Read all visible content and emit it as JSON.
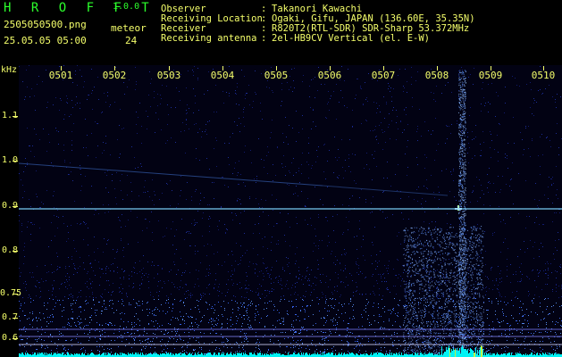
{
  "app": {
    "brand": "H R O F F T",
    "version": "1.0.0",
    "filename": "2505050500.png",
    "datetime": "25.05.05 05:00",
    "meteor_label": "meteor",
    "meteor_count": "24"
  },
  "info": {
    "rows": [
      {
        "label": "Observer",
        "value": "Takanori Kawachi"
      },
      {
        "label": "Receiving Location",
        "value": "Ogaki, Gifu, JAPAN (136.60E, 35.35N)"
      },
      {
        "label": "Receiver",
        "value": "R820T2(RTL-SDR) SDR-Sharp 53.372MHz"
      },
      {
        "label": "Receiving antenna",
        "value": "2el-HB9CV Vertical (el. E-W)"
      }
    ]
  },
  "axes": {
    "khz_label": "kHz",
    "time_labels": [
      "0501",
      "0502",
      "0503",
      "0504",
      "0505",
      "0506",
      "0507",
      "0508",
      "0509",
      "0510"
    ],
    "freq_labels": [
      "1.1",
      "1.0",
      "0.9",
      "0.8",
      "0.75",
      "0.7",
      "0.6"
    ]
  },
  "colors": {
    "accent_green": "#2cff2c",
    "label_yellow": "#f5ff6b",
    "noise_blue": "#2d4cff",
    "signal_cyan": "#7fd8ff",
    "bottom_cyan": "#00ffff"
  }
}
